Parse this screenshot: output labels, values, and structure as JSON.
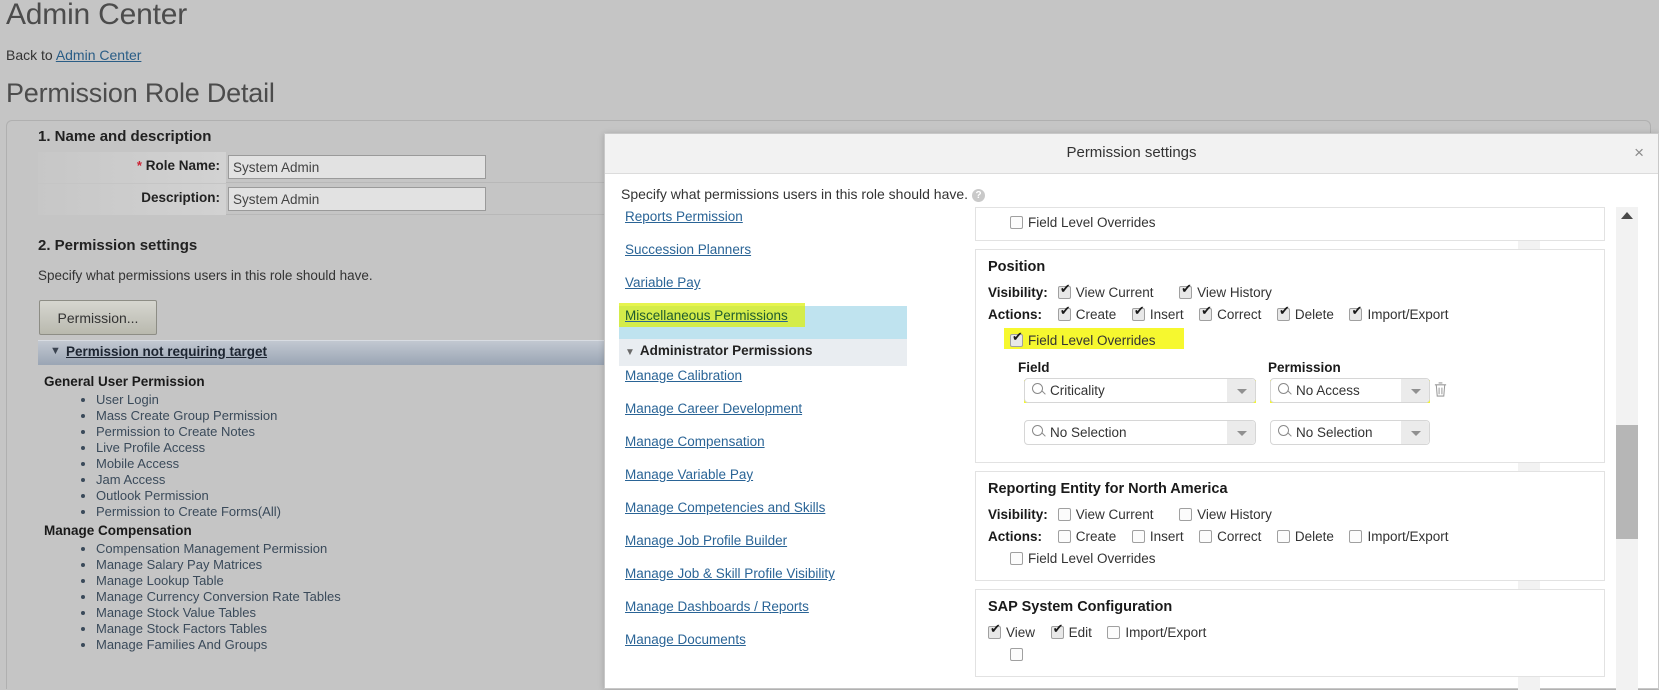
{
  "background": {
    "app_title": "Admin Center",
    "back_to_prefix": "Back to ",
    "back_to_link": "Admin Center",
    "detail_title": "Permission Role Detail",
    "section1_title": "1. Name and description",
    "role_name_label": "Role Name:",
    "role_name_value": "System Admin",
    "description_label": "Description:",
    "description_value": "System Admin",
    "section2_title": "2. Permission settings",
    "section2_subtitle": "Specify what permissions users in this role should have.",
    "permission_button": "Permission...",
    "collapse_bar_label": "Permission not requiring target",
    "groups": [
      {
        "title": "General User Permission",
        "items": [
          "User Login",
          "Mass Create Group Permission",
          "Permission to Create Notes",
          "Live Profile Access",
          "Mobile Access",
          "Jam Access",
          "Outlook Permission",
          "Permission to Create Forms(All)"
        ]
      },
      {
        "title": "Manage Compensation",
        "items": [
          "Compensation Management Permission",
          "Manage Salary Pay Matrices",
          "Manage Lookup Table",
          "Manage Currency Conversion Rate Tables",
          "Manage Stock Value Tables",
          "Manage Stock Factors Tables",
          "Manage Families And Groups"
        ]
      }
    ]
  },
  "modal": {
    "title": "Permission settings",
    "close_label": "×",
    "subtitle": "Specify what permissions users in this role should have.",
    "help_glyph": "?",
    "nav": {
      "links_top": [
        "Reports Permission",
        "Succession Planners",
        "Variable Pay"
      ],
      "selected_link": "Miscellaneous Permissions",
      "group_header": "Administrator Permissions",
      "group_arrow": "▼",
      "links_group": [
        "Manage Calibration",
        "Manage Career Development",
        "Manage Compensation",
        "Manage Variable Pay",
        "Manage Competencies and Skills",
        "Manage Job Profile Builder",
        "Manage Job & Skill Profile Visibility",
        "Manage Dashboards / Reports",
        "Manage Documents"
      ]
    },
    "labels": {
      "visibility": "Visibility:",
      "actions": "Actions:",
      "view_current": "View Current",
      "view_history": "View History",
      "create": "Create",
      "insert": "Insert",
      "correct": "Correct",
      "delete": "Delete",
      "import_export": "Import/Export",
      "field_level_overrides": "Field Level Overrides",
      "field_col": "Field",
      "permission_col": "Permission",
      "view": "View",
      "edit": "Edit"
    },
    "sections": {
      "top_partial_flo": "Field Level Overrides",
      "position": {
        "title": "Position",
        "visibility": {
          "view_current": true,
          "view_history": true
        },
        "actions": {
          "create": true,
          "insert": true,
          "correct": true,
          "delete": true,
          "import_export": true
        },
        "field_level_overrides": true,
        "rows": [
          {
            "field": "Criticality",
            "permission": "No Access",
            "highlighted": true,
            "has_delete": true
          },
          {
            "field": "No Selection",
            "permission": "No Selection",
            "highlighted": false,
            "has_delete": false
          }
        ]
      },
      "reporting_entity": {
        "title": "Reporting Entity for North America",
        "visibility": {
          "view_current": false,
          "view_history": false
        },
        "actions": {
          "create": false,
          "insert": false,
          "correct": false,
          "delete": false,
          "import_export": false
        },
        "field_level_overrides": false
      },
      "sap_system_config": {
        "title": "SAP System Configuration",
        "view": true,
        "edit": true,
        "import_export": false
      }
    }
  },
  "colors": {
    "highlight_yellow": "#f4f70a",
    "selection_blue": "#bfe3ef",
    "link_blue": "#2a6496",
    "page_bg": "#c5c5c5"
  }
}
